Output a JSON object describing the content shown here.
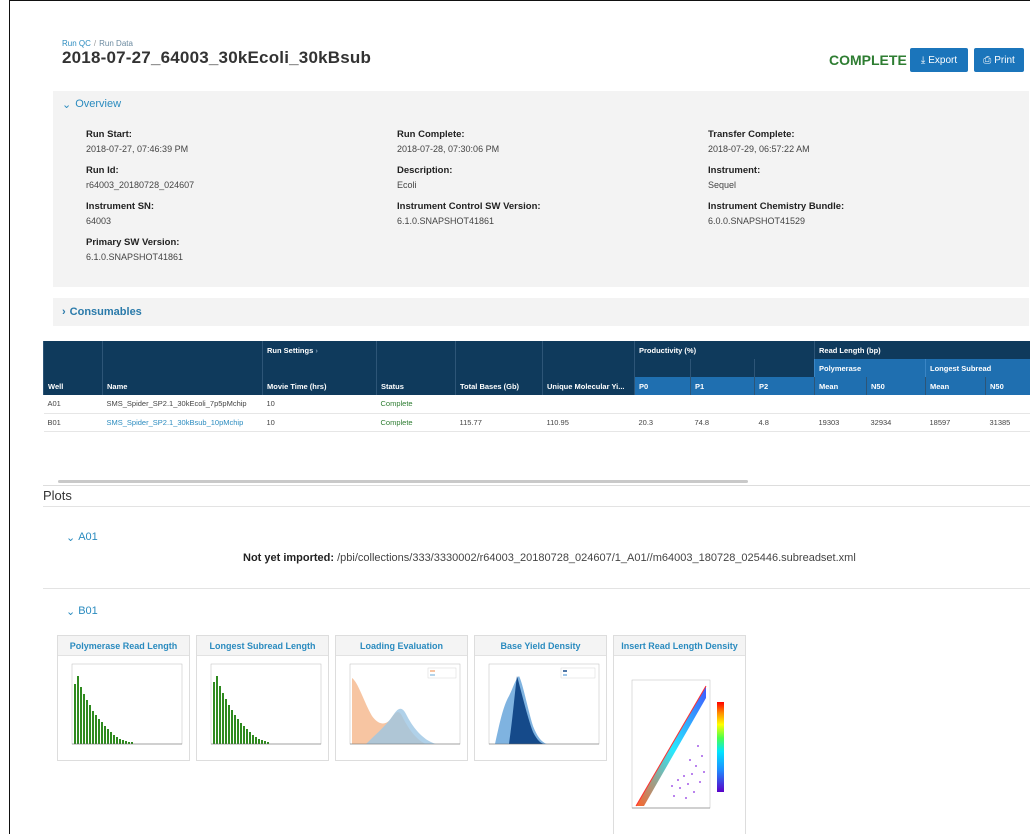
{
  "header": {
    "breadcrumb": {
      "home": "Run QC",
      "separator": "/",
      "current": "Run Data"
    },
    "title": "2018-07-27_64003_30kEcoli_30kBsub",
    "status": "COMPLETE",
    "export_label": "Export",
    "print_label": "Print"
  },
  "overview": {
    "label": "Overview",
    "fields": [
      {
        "label": "Run Start:",
        "value": "2018-07-27, 07:46:39 PM"
      },
      {
        "label": "Run Complete:",
        "value": "2018-07-28, 07:30:06 PM"
      },
      {
        "label": "Transfer Complete:",
        "value": "2018-07-29, 06:57:22 AM"
      },
      {
        "label": "Run Id:",
        "value": "r64003_20180728_024607"
      },
      {
        "label": "Description:",
        "value": "Ecoli"
      },
      {
        "label": "Instrument:",
        "value": "Sequel"
      },
      {
        "label": "Instrument SN:",
        "value": "64003"
      },
      {
        "label": "Instrument Control SW Version:",
        "value": "6.1.0.SNAPSHOT41861"
      },
      {
        "label": "Instrument Chemistry Bundle:",
        "value": "6.0.0.SNAPSHOT41529"
      },
      {
        "label": "Primary SW Version:",
        "value": "6.1.0.SNAPSHOT41861"
      }
    ]
  },
  "consumables": {
    "label": "Consumables"
  },
  "table": {
    "groups": {
      "run_settings": "Run Settings",
      "productivity": "Productivity (%)",
      "read_length": "Read Length (bp)"
    },
    "subgroups": {
      "polymerase": "Polymerase",
      "longest_subread": "Longest Subread"
    },
    "columns": [
      "Well",
      "Name",
      "Movie Time (hrs)",
      "Status",
      "Total Bases (Gb)",
      "Unique Molecular Yi...",
      "P0",
      "P1",
      "P2",
      "Mean",
      "N50",
      "Mean",
      "N50"
    ],
    "rows": [
      {
        "well": "A01",
        "name": "SMS_Spider_SP2.1_30kEcoli_7p5pMchip",
        "movie": "10",
        "status": "Complete",
        "bases": "",
        "uny": "",
        "p0": "",
        "p1": "",
        "p2": "",
        "pmean": "",
        "pn50": "",
        "lmean": "",
        "ln50": ""
      },
      {
        "well": "B01",
        "name": "SMS_Spider_SP2.1_30kBsub_10pMchip",
        "movie": "10",
        "status": "Complete",
        "bases": "115.77",
        "uny": "110.95",
        "p0": "20.3",
        "p1": "74.8",
        "p2": "4.8",
        "pmean": "19303",
        "pn50": "32934",
        "lmean": "18597",
        "ln50": "31385"
      }
    ]
  },
  "plots": {
    "heading": "Plots",
    "a01": {
      "label": "A01",
      "message_bold": "Not yet imported:",
      "message_path": "/pbi/collections/333/3330002/r64003_20180728_024607/1_A01//m64003_180728_025446.subreadset.xml"
    },
    "b01": {
      "label": "B01",
      "cards": [
        {
          "title": "Polymerase Read Length"
        },
        {
          "title": "Longest Subread Length"
        },
        {
          "title": "Loading Evaluation"
        },
        {
          "title": "Base Yield Density"
        },
        {
          "title": "Insert Read Length Density"
        }
      ]
    }
  },
  "colors": {
    "primary": "#1b75bb",
    "status_green": "#2e7d32",
    "table_header": "#0f3a5c",
    "histogram": "#2f8a1f"
  }
}
